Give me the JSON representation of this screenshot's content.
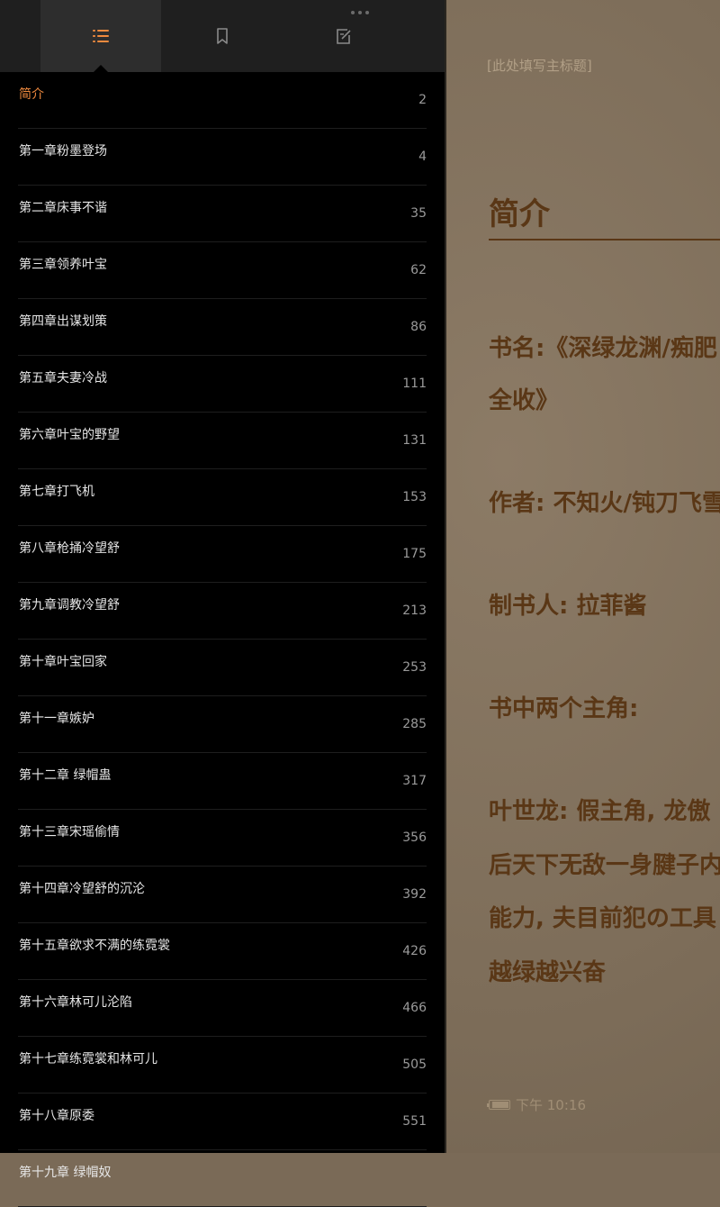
{
  "reader": {
    "header_placeholder": "[此处填写主标题]",
    "chapter_title": "简介",
    "lines": [
      "书名:《深绿龙渊/痴肥",
      "全收》",
      "作者: 不知火/钝刀飞雪",
      "制书人: 拉菲酱",
      "书中两个主角:",
      "叶世龙: 假主角, 龙傲",
      "后天下无敌一身腱子内",
      "能力, 夫目前犯の工具",
      "越绿越兴奋"
    ],
    "time": "下午 10:16"
  },
  "tabs": {
    "contents": "contents-list-icon",
    "bookmarks": "bookmark-icon",
    "notes": "note-edit-icon"
  },
  "colors": {
    "accent": "#f08a3e",
    "reader_text": "#5a3716"
  },
  "toc": [
    {
      "title": "简介",
      "page": "2",
      "current": true
    },
    {
      "title": "第一章粉墨登场",
      "page": "4"
    },
    {
      "title": "第二章床事不谐",
      "page": "35"
    },
    {
      "title": "第三章领养叶宝",
      "page": "62"
    },
    {
      "title": "第四章出谋划策",
      "page": "86"
    },
    {
      "title": "第五章夫妻冷战",
      "page": "111"
    },
    {
      "title": "第六章叶宝的野望",
      "page": "131"
    },
    {
      "title": "第七章打飞机",
      "page": "153"
    },
    {
      "title": "第八章枪捅冷望舒",
      "page": "175"
    },
    {
      "title": "第九章调教冷望舒",
      "page": "213"
    },
    {
      "title": "第十章叶宝回家",
      "page": "253"
    },
    {
      "title": "第十一章嫉妒",
      "page": "285"
    },
    {
      "title": "第十二章 绿帽蛊",
      "page": "317"
    },
    {
      "title": "第十三章宋瑶偷情",
      "page": "356"
    },
    {
      "title": "第十四章冷望舒的沉沦",
      "page": "392"
    },
    {
      "title": "第十五章欲求不满的练霓裳",
      "page": "426"
    },
    {
      "title": "第十六章林可儿沦陷",
      "page": "466"
    },
    {
      "title": "第十七章练霓裳和林可儿",
      "page": "505"
    },
    {
      "title": "第十八章原委",
      "page": "551"
    },
    {
      "title": "第十九章 绿帽奴",
      "page": ""
    }
  ]
}
